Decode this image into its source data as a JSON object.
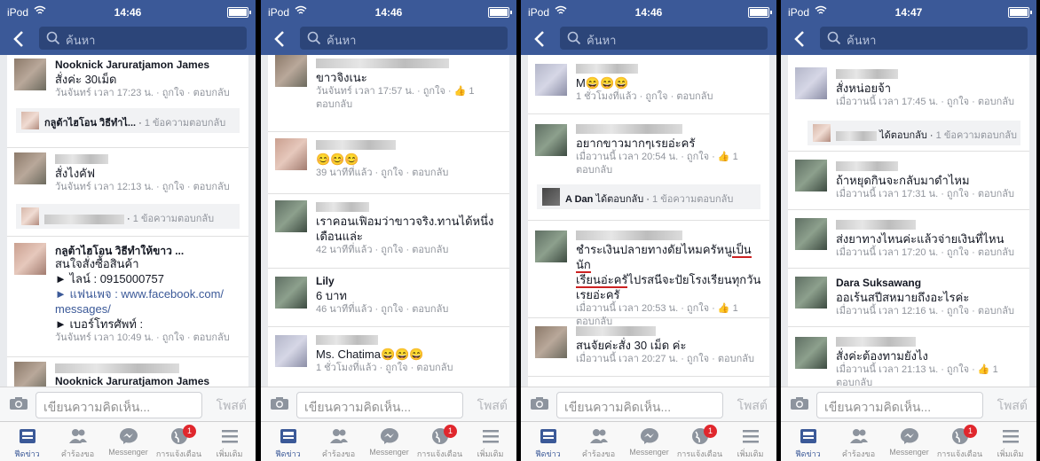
{
  "status": {
    "device": "iPod",
    "times": [
      "14:46",
      "14:46",
      "14:46",
      "14:47"
    ]
  },
  "search": {
    "placeholder": "ค้นหา"
  },
  "composer": {
    "placeholder": "เขียนความคิดเห็น...",
    "post": "โพสต์"
  },
  "tabs": [
    {
      "label": "ฟีดข่าว",
      "icon": "news-feed-icon"
    },
    {
      "label": "คำร้องขอ",
      "icon": "friend-requests-icon"
    },
    {
      "label": "Messenger",
      "icon": "messenger-icon"
    },
    {
      "label": "การแจ้งเตือน",
      "icon": "globe-icon",
      "badge": "1"
    },
    {
      "label": "เพิ่มเติม",
      "icon": "more-menu-icon"
    }
  ],
  "actions": {
    "like": "ถูกใจ",
    "reply": "ตอบกลับ",
    "replied": "ได้ตอบกลับ",
    "reply_count": "1 ข้อความตอบกลับ",
    "like_count": "1"
  },
  "screens": [
    {
      "comments": [
        {
          "name": "Nooknick Jaruratjamon James",
          "text": "สั่งค่ะ 30เม็ด",
          "time": "วันจันทร์ เวลา 17:23 น.",
          "reply": "กลูต้าไฮโอน วิธีทำไ..."
        },
        {
          "name": "",
          "text": "สั่งไงคัฟ",
          "time": "วันจันทร์ เวลา 12:13 น.",
          "reply": ""
        },
        {
          "name": "กลูต้าไฮโอน วิธีทำให้ขาว ...",
          "lines": [
            "สนใจสั่งซื้อสินค้า",
            "► ไลน์ : 0915000757",
            "► แฟนเพจ : www.facebook.com/",
            "messages/",
            "► เบอร์โทรศัพท์ :"
          ],
          "time": "วันจันทร์ เวลา 10:49 น."
        },
        {
          "name": "Nooknick Jaruratjamon James"
        }
      ]
    },
    {
      "comments": [
        {
          "text": "ขาวจิงเนะ",
          "time": "วันจันทร์ เวลา 17:57 น."
        },
        {
          "text": "😊😊😊",
          "time": "39 นาทีที่แล้ว"
        },
        {
          "text": "เราคอนเฟิอมว่าขาวจริง.ทานได้หนึ่งเดือนแล่ะ",
          "time": "42 นาทีที่แล้ว"
        },
        {
          "name": "Lily",
          "text": "6 บาท",
          "time": "46 นาทีที่แล้ว"
        },
        {
          "text": "Ms. Chatima😄😄😄",
          "time": "1 ชั่วโมงที่แล้ว"
        }
      ]
    },
    {
      "comments": [
        {
          "text": "M😄😄😄",
          "time": "1 ชั่วโมงที่แล้ว"
        },
        {
          "text": "อยากขาวมากๆเรยอ่ะครั",
          "time": "เมื่อวานนี้ เวลา 20:54 น.",
          "reply": "A Dan"
        },
        {
          "text_a": "ชำระเงินปลายทางดัยไหมครัหนู",
          "text_u": "เป็นนัก",
          "text_b": "เรียนอ่ะครั",
          "text_c": "ไปรสนีจะปัยโรงเรียนทุกวันเรยอ่ะครั",
          "time": "เมื่อวานนี้ เวลา 20:53 น."
        },
        {
          "text": "สนจัยค่ะสั่ง 30 เม็ด ค่ะ",
          "time": "เมื่อวานนี้ เวลา 20:27 น."
        }
      ]
    },
    {
      "comments": [
        {
          "text": "สั่งหน่อยจ้า",
          "time": "เมื่อวานนี้ เวลา 17:45 น."
        },
        {
          "text": "ถ้าหยุดกินจะกลับมาดำไหม",
          "time": "เมื่อวานนี้ เวลา 17:31 น."
        },
        {
          "text": "ส่งยาทางไหนค่ะแล้วจ่ายเงินที่ไหน",
          "time": "เมื่อวานนี้ เวลา 17:20 น."
        },
        {
          "name": "Dara Suksawang",
          "text": "ออเร้นสปีสหมายถึงอะไรค่ะ",
          "time": "เมื่อวานนี้ เวลา 12:16 น."
        },
        {
          "text": "สั่งค่ะต้องทามยังไง",
          "time": "เมื่อวานนี้ เวลา 21:13 น."
        }
      ]
    }
  ]
}
